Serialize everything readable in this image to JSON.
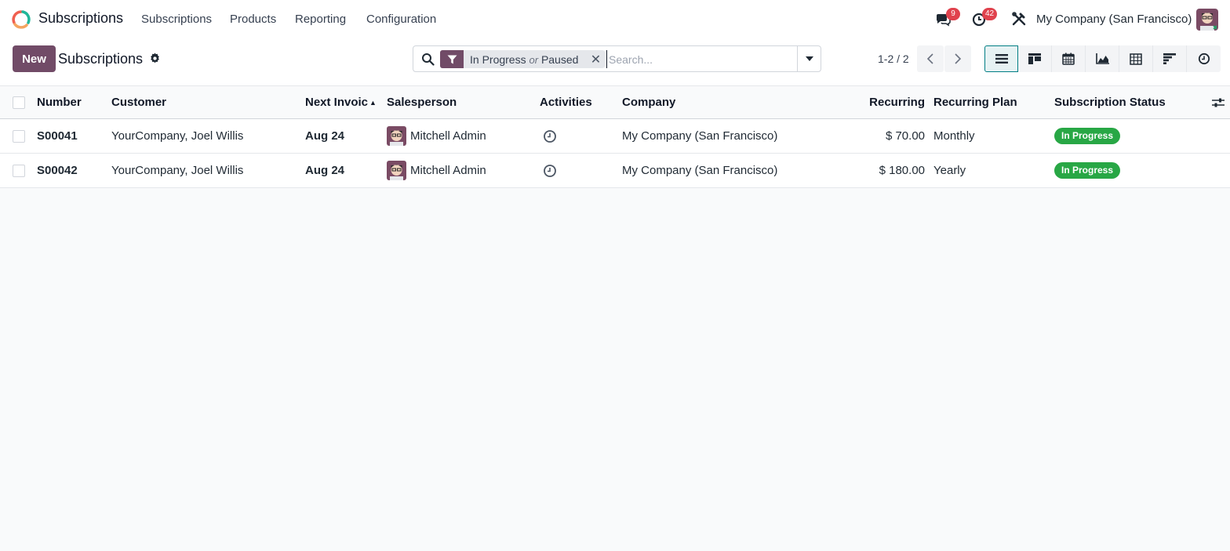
{
  "navbar": {
    "app_title": "Subscriptions",
    "menu": [
      "Subscriptions",
      "Products",
      "Reporting",
      "Configuration"
    ],
    "messages_count": "9",
    "activities_count": "42",
    "company": "My Company (San Francisco)",
    "colors": {
      "badge": "#e0424d",
      "brand": "#714b67"
    }
  },
  "control_panel": {
    "new_label": "New",
    "title": "Subscriptions",
    "search": {
      "facet_values": [
        "In Progress",
        "Paused"
      ],
      "facet_separator": "or",
      "placeholder": "Search...",
      "value": ""
    },
    "pager": "1-2 / 2",
    "views": [
      "list-icon",
      "kanban-icon",
      "calendar-icon",
      "graph-icon",
      "pivot-icon",
      "gantt-icon",
      "activity-icon"
    ],
    "active_view": "list"
  },
  "list": {
    "columns": {
      "number": "Number",
      "customer": "Customer",
      "next_invoice": "Next Invoic",
      "salesperson": "Salesperson",
      "activities": "Activities",
      "company": "Company",
      "recurring": "Recurring",
      "plan": "Recurring Plan",
      "status": "Subscription Status"
    },
    "rows": [
      {
        "number": "S00041",
        "customer": "YourCompany, Joel Willis",
        "next_invoice": "Aug 24",
        "salesperson": "Mitchell Admin",
        "company": "My Company (San Francisco)",
        "recurring": "$ 70.00",
        "plan": "Monthly",
        "status": "In Progress"
      },
      {
        "number": "S00042",
        "customer": "YourCompany, Joel Willis",
        "next_invoice": "Aug 24",
        "salesperson": "Mitchell Admin",
        "company": "My Company (San Francisco)",
        "recurring": "$ 180.00",
        "plan": "Yearly",
        "status": "In Progress"
      }
    ],
    "status_color": "#28a745"
  }
}
